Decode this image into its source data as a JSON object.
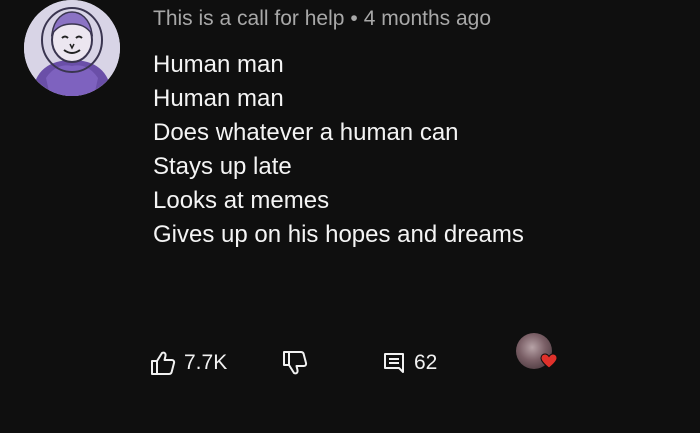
{
  "comment": {
    "author": "This is a call for help",
    "separator": "•",
    "timestamp": "4 months ago",
    "lines": [
      "Human man",
      "Human man",
      "Does whatever a human can",
      "Stays up late",
      "Looks at memes",
      "Gives up on his hopes and dreams"
    ],
    "likes": "7.7K",
    "replies": "62",
    "icons": {
      "like": "thumbs-up-icon",
      "dislike": "thumbs-down-icon",
      "reply": "comment-icon",
      "heart": "heart-icon"
    },
    "colors": {
      "background": "#0f0f0f",
      "text": "#f1f1f1",
      "meta": "#a8a8a8",
      "heart": "#e0312b"
    }
  }
}
